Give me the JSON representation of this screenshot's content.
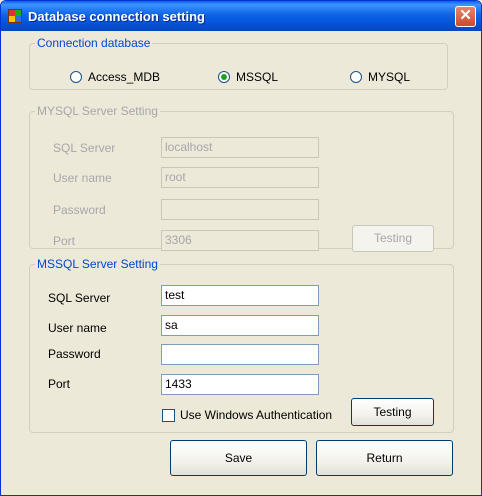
{
  "window": {
    "title": "Database connection setting",
    "close_glyph": "✕"
  },
  "connection_db": {
    "legend": "Connection database",
    "options": [
      "Access_MDB",
      "MSSQL",
      "MYSQL"
    ],
    "selected": "MSSQL"
  },
  "mysql": {
    "legend": "MYSQL Server Setting",
    "sql_server_label": "SQL Server",
    "user_name_label": "User name",
    "password_label": "Password",
    "port_label": "Port",
    "sql_server_value": "localhost",
    "user_name_value": "root",
    "password_value": "",
    "port_value": "3306",
    "testing_label": "Testing"
  },
  "mssql": {
    "legend": "MSSQL Server Setting",
    "sql_server_label": "SQL Server",
    "user_name_label": "User name",
    "password_label": "Password",
    "port_label": "Port",
    "sql_server_value": "test",
    "user_name_value": "sa",
    "password_value": "",
    "port_value": "1433",
    "windows_auth_label": "Use Windows Authentication",
    "windows_auth_checked": false,
    "testing_label": "Testing"
  },
  "footer": {
    "save_label": "Save",
    "return_label": "Return"
  }
}
